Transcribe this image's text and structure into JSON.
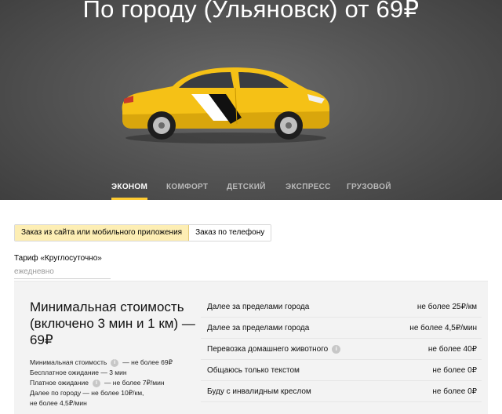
{
  "hero": {
    "title": "По городу (Ульяновск) от 69₽"
  },
  "tabs": [
    {
      "label": "ЭКОНОМ",
      "active": true
    },
    {
      "label": "КОМФОРТ",
      "active": false
    },
    {
      "label": "ДЕТСКИЙ",
      "active": false
    },
    {
      "label": "ЭКСПРЕСС",
      "active": false
    },
    {
      "label": "ГРУЗОВОЙ",
      "active": false
    }
  ],
  "order_toggle": {
    "options": [
      {
        "label": "Заказ из сайта или мобильного приложения",
        "active": true
      },
      {
        "label": "Заказ по телефону",
        "active": false
      }
    ]
  },
  "tariff": {
    "name": "Тариф «Круглосуточно»",
    "schedule": "ежедневно"
  },
  "minimum": {
    "title": "Минимальная стоимость (включено 3 мин и 1 км) — 69₽",
    "items": [
      {
        "label": "Минимальная стоимость",
        "info": true,
        "value": "— не более 69₽"
      },
      {
        "label": "Бесплатное ожидание — 3 мин",
        "info": false,
        "value": ""
      },
      {
        "label": "Платное ожидание",
        "info": true,
        "value": "— не более 7₽/мин"
      },
      {
        "label": "Далее по городу — не более 10₽/км,",
        "info": false,
        "value": ""
      },
      {
        "label": "не более 4,5₽/мин",
        "info": false,
        "value": ""
      }
    ]
  },
  "rates": [
    {
      "label": "Далее за пределами города",
      "info": false,
      "value": "не более 25₽/км"
    },
    {
      "label": "Далее за пределами города",
      "info": false,
      "value": "не более 4,5₽/мин"
    },
    {
      "label": "Перевозка домашнего животного",
      "info": true,
      "value": "не более 40₽"
    },
    {
      "label": "Общаюсь только текстом",
      "info": false,
      "value": "не более 0₽"
    },
    {
      "label": "Буду с инвалидным креслом",
      "info": false,
      "value": "не более 0₽"
    }
  ],
  "colors": {
    "accent": "#ffcc33",
    "hero_bg": "#565656",
    "toggle_active_bg": "#fdeeb4",
    "panel_bg": "#f3f3f3"
  }
}
